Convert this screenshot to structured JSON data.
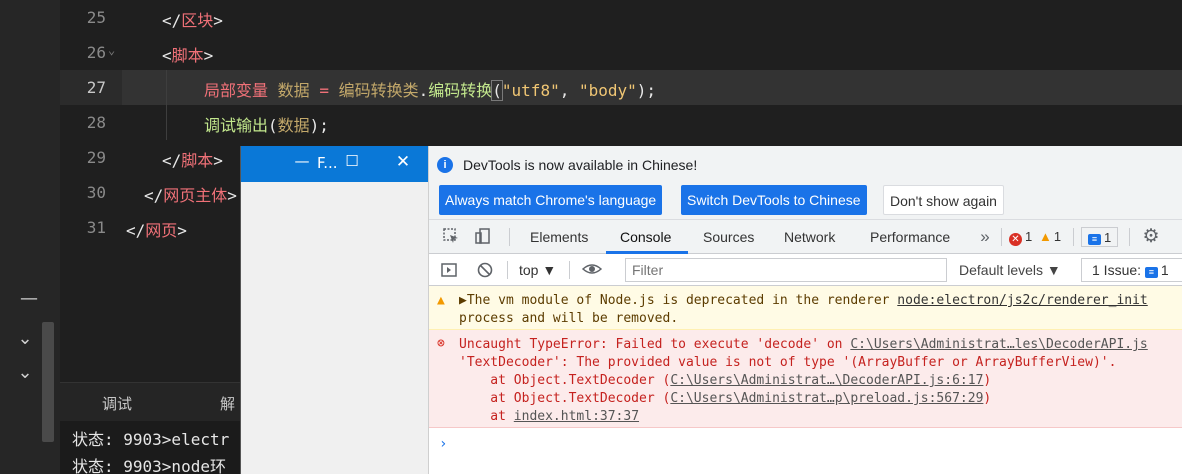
{
  "editor": {
    "lines": [
      {
        "num": "25",
        "tag_open": "</",
        "tag": "区块",
        "tag_close": ">"
      },
      {
        "num": "26",
        "tag_open": "<",
        "tag": "脚本",
        "tag_close": ">"
      },
      {
        "num": "27",
        "var_kw": "局部变量",
        "var_name": "数据",
        "op": "=",
        "cls": "编码转换类",
        "dot": ".",
        "fn": "编码转换",
        "paren_open": "(",
        "arg1": "\"utf8\"",
        "comma": ", ",
        "arg2": "\"body\"",
        "paren_close": ");"
      },
      {
        "num": "28",
        "fn": "调试输出",
        "paren_open": "(",
        "arg": "数据",
        "paren_close": ");"
      },
      {
        "num": "29",
        "tag_open": "</",
        "tag": "脚本",
        "tag_close": ">"
      },
      {
        "num": "30",
        "tag_open": "</",
        "tag": "网页主体",
        "tag_close": ">"
      },
      {
        "num": "31",
        "tag_open": "</",
        "tag": "网页",
        "tag_close": ">"
      }
    ],
    "fold_marker": "⌄"
  },
  "bottom_panel": {
    "tab_debug": "调试",
    "tab_other": "解",
    "status_lines": [
      "状态: 9903>electr",
      "状态: 9903>node环"
    ]
  },
  "app_window": {
    "title": "F...",
    "minimize": "—",
    "maximize": "☐",
    "close": "✕"
  },
  "devtools": {
    "banner": {
      "message": "DevTools is now available in Chinese!",
      "btn_match": "Always match Chrome's language",
      "btn_switch": "Switch DevTools to Chinese",
      "btn_dismiss": "Don't show again"
    },
    "tabs": [
      "Elements",
      "Console",
      "Sources",
      "Network",
      "Performance"
    ],
    "more_tabs": "»",
    "error_count": "1",
    "warning_count": "1",
    "message_count": "1",
    "context": "top",
    "filter_placeholder": "Filter",
    "levels": "Default levels ▼",
    "issues_label": "1 Issue:",
    "issues_count": "1",
    "warning": {
      "line1_prefix": "▶The vm module of Node.js is deprecated in the renderer ",
      "line1_link": "node:electron/js2c/renderer_init",
      "line2": "process and will be removed."
    },
    "error": {
      "line1_text": "Uncaught TypeError: Failed to execute 'decode' on ",
      "line1_link": "C:\\Users\\Administrat…les\\DecoderAPI.js",
      "line2": "'TextDecoder': The provided value is not of type '(ArrayBuffer or ArrayBufferView)'.",
      "stack": [
        {
          "prefix": "    at Object.TextDecoder (",
          "link": "C:\\Users\\Administrat…\\DecoderAPI.js:6:17",
          "suffix": ")"
        },
        {
          "prefix": "    at Object.TextDecoder (",
          "link": "C:\\Users\\Administrat…p\\preload.js:567:29",
          "suffix": ")"
        },
        {
          "prefix": "    at ",
          "link": "index.html:37:37",
          "suffix": ""
        }
      ]
    },
    "prompt": "›"
  },
  "colors": {
    "accent": "#1a73e8",
    "error": "#d93025",
    "warning": "#f29900",
    "titlebar": "#0a78d7"
  }
}
